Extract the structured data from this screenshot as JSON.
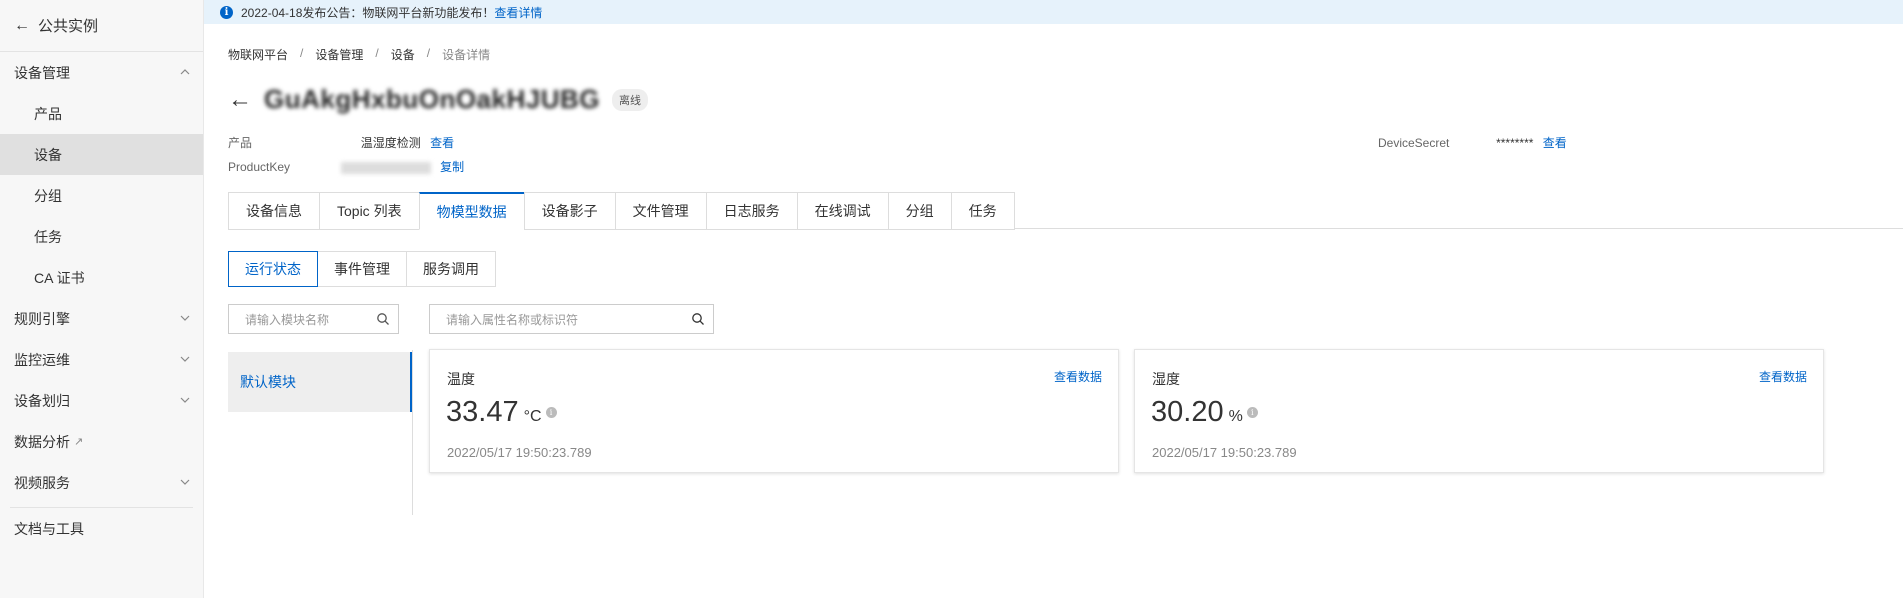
{
  "sidebar": {
    "back_label": "公共实例",
    "items": [
      {
        "label": "设备管理",
        "expand": "up"
      },
      {
        "label": "产品"
      },
      {
        "label": "设备"
      },
      {
        "label": "分组"
      },
      {
        "label": "任务"
      },
      {
        "label": "CA 证书"
      },
      {
        "label": "规则引擎",
        "expand": "down"
      },
      {
        "label": "监控运维",
        "expand": "down"
      },
      {
        "label": "设备划归",
        "expand": "down"
      },
      {
        "label": "数据分析"
      },
      {
        "label": "视频服务",
        "expand": "down"
      },
      {
        "label": "文档与工具"
      }
    ]
  },
  "notice": {
    "text": "2022-04-18发布公告：物联网平台新功能发布！",
    "link": "查看详情"
  },
  "breadcrumb": [
    "物联网平台",
    "设备管理",
    "设备",
    "设备详情"
  ],
  "device": {
    "name": "GuAkgHxbuOnOakHJUBG",
    "status": "离线",
    "product_label": "产品",
    "product_value": "温湿度检测",
    "product_link": "查看",
    "productkey_label": "ProductKey",
    "productkey_copy": "复制",
    "secret_label": "DeviceSecret",
    "secret_value": "********",
    "secret_link": "查看"
  },
  "tabs": [
    "设备信息",
    "Topic 列表",
    "物模型数据",
    "设备影子",
    "文件管理",
    "日志服务",
    "在线调试",
    "分组",
    "任务"
  ],
  "subtabs": [
    "运行状态",
    "事件管理",
    "服务调用"
  ],
  "module_search_placeholder": "请输入模块名称",
  "property_search_placeholder": "请输入属性名称或标识符",
  "modules": [
    "默认模块"
  ],
  "cards": [
    {
      "name": "温度",
      "link": "查看数据",
      "value": "33.47",
      "unit": "°C",
      "time": "2022/05/17 19:50:23.789"
    },
    {
      "name": "湿度",
      "link": "查看数据",
      "value": "30.20",
      "unit": "%",
      "time": "2022/05/17 19:50:23.789"
    }
  ],
  "colors": {
    "accent": "#0064c8",
    "notice_bg": "#e6f2fb",
    "sidebar_active": "#e0e0e0"
  }
}
